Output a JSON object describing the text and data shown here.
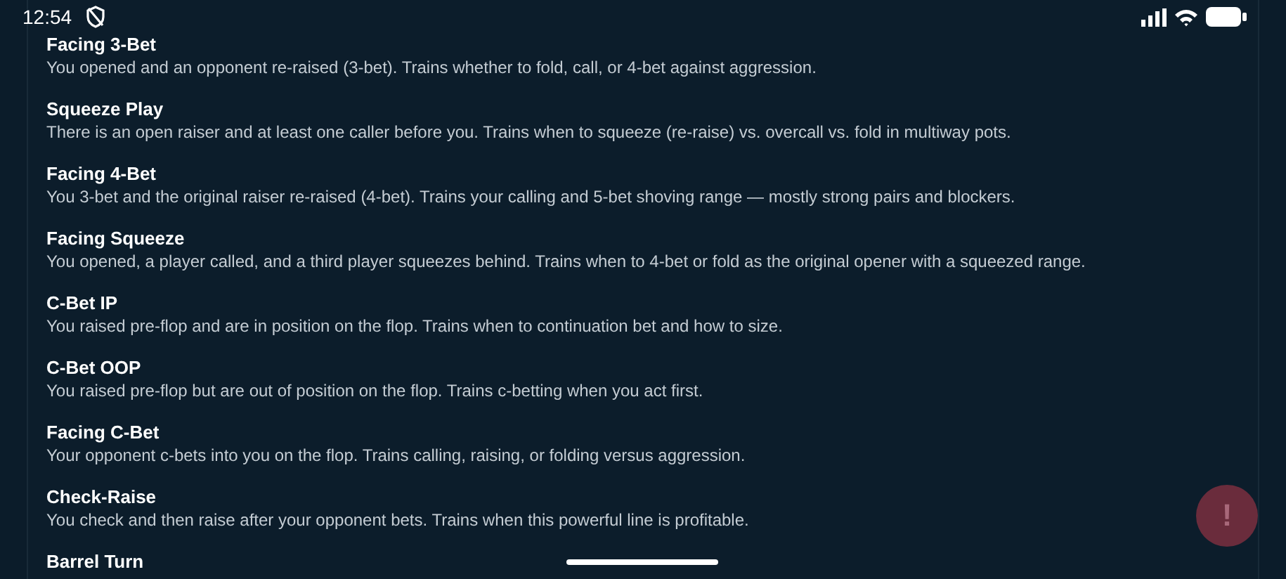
{
  "status_bar": {
    "time": "12:54"
  },
  "scenarios": [
    {
      "title": "Facing 3-Bet",
      "description": "You opened and an opponent re-raised (3-bet). Trains whether to fold, call, or 4-bet against aggression."
    },
    {
      "title": "Squeeze Play",
      "description": "There is an open raiser and at least one caller before you. Trains when to squeeze (re-raise) vs. overcall vs. fold in multiway pots."
    },
    {
      "title": "Facing 4-Bet",
      "description": "You 3-bet and the original raiser re-raised (4-bet). Trains your calling and 5-bet shoving range — mostly strong pairs and blockers."
    },
    {
      "title": "Facing Squeeze",
      "description": "You opened, a player called, and a third player squeezes behind. Trains when to 4-bet or fold as the original opener with a squeezed range."
    },
    {
      "title": "C-Bet IP",
      "description": "You raised pre-flop and are in position on the flop. Trains when to continuation bet and how to size."
    },
    {
      "title": "C-Bet OOP",
      "description": "You raised pre-flop but are out of position on the flop. Trains c-betting when you act first."
    },
    {
      "title": "Facing C-Bet",
      "description": "Your opponent c-bets into you on the flop. Trains calling, raising, or folding versus aggression."
    },
    {
      "title": "Check-Raise",
      "description": "You check and then raise after your opponent bets. Trains when this powerful line is profitable."
    },
    {
      "title": "Barrel Turn"
    }
  ],
  "alert_button": {
    "label": "!"
  }
}
